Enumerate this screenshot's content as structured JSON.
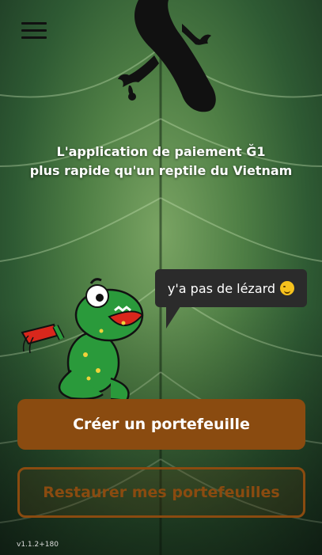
{
  "header": {
    "menu_icon": "hamburger-menu-icon"
  },
  "hero": {
    "line1": "L'application de paiement Ğ1",
    "line2": "plus rapide qu'un reptile du Vietnam"
  },
  "speech_bubble": {
    "text": "y'a pas de lézard",
    "emoji": "winking-face-icon"
  },
  "actions": {
    "create_label": "Créer un portefeuille",
    "restore_label": "Restaurer mes portefeuilles"
  },
  "footer": {
    "version": "v1.1.2+180"
  },
  "colors": {
    "accent": "#8a4b10",
    "bubble": "#2b2b2b",
    "leaf": "#4f7f45"
  }
}
